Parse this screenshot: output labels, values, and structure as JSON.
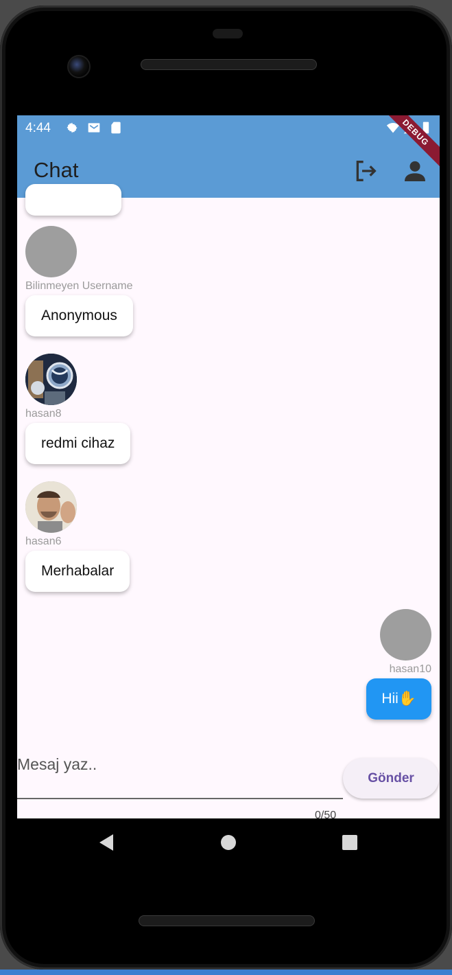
{
  "status_bar": {
    "time": "4:44",
    "icons": [
      "settings-icon",
      "mail-icon",
      "sd-card-icon"
    ],
    "right_icons": [
      "wifi-icon",
      "signal-icon",
      "battery-icon"
    ]
  },
  "app_bar": {
    "title": "Chat",
    "debug_banner": "DEBUG",
    "actions": [
      "logout-icon",
      "person-icon"
    ]
  },
  "messages": [
    {
      "user": "Bilinmeyen Username",
      "text": "Anonymous",
      "side": "left",
      "avatar": "placeholder"
    },
    {
      "user": "hasan8",
      "text": "redmi cihaz",
      "side": "left",
      "avatar": "space-photo"
    },
    {
      "user": "hasan6",
      "text": "Merhabalar",
      "side": "left",
      "avatar": "selfie-photo"
    },
    {
      "user": "hasan10",
      "text": "Hii✋",
      "side": "right",
      "avatar": "placeholder"
    }
  ],
  "composer": {
    "placeholder": "Mesaj yaz..",
    "counter": "0/50",
    "send_label": "Gönder"
  },
  "colors": {
    "app_bar": "#5b9bd5",
    "my_bubble": "#2196f3",
    "background": "#fff8fe",
    "send_text": "#6750a4"
  }
}
